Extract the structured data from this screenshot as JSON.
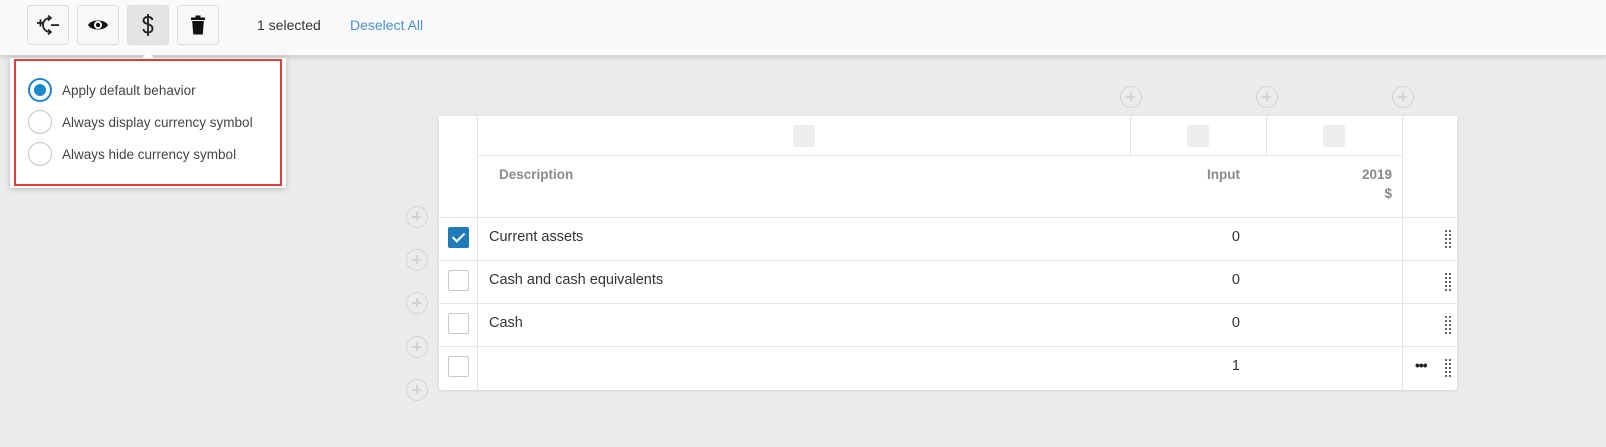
{
  "toolbar": {
    "buttons": [
      {
        "name": "adjust-sign",
        "icon": "plus-minus-cycle-icon"
      },
      {
        "name": "visibility",
        "icon": "eye-icon"
      },
      {
        "name": "currency",
        "icon": "dollar-icon",
        "active": true
      },
      {
        "name": "delete",
        "icon": "trash-icon"
      }
    ],
    "selected_count": "1 selected",
    "deselect_label": "Deselect All"
  },
  "currency_popover": {
    "options": [
      {
        "label": "Apply default behavior",
        "checked": true
      },
      {
        "label": "Always display currency symbol",
        "checked": false
      },
      {
        "label": "Always hide currency symbol",
        "checked": false
      }
    ]
  },
  "table": {
    "headers": {
      "description": "Description",
      "input": "Input",
      "year": "2019",
      "currency": "$"
    },
    "rows": [
      {
        "description": "Current assets",
        "input": "0",
        "checked": true
      },
      {
        "description": "Cash and cash equivalents",
        "input": "0",
        "checked": false
      },
      {
        "description": "Cash",
        "input": "0",
        "checked": false
      },
      {
        "description": "",
        "input": "1",
        "checked": false
      }
    ],
    "more_label": "•••"
  },
  "colors": {
    "accent": "#1f87c7",
    "link": "#4a8fd9",
    "highlight_outline": "#e03b3b"
  }
}
